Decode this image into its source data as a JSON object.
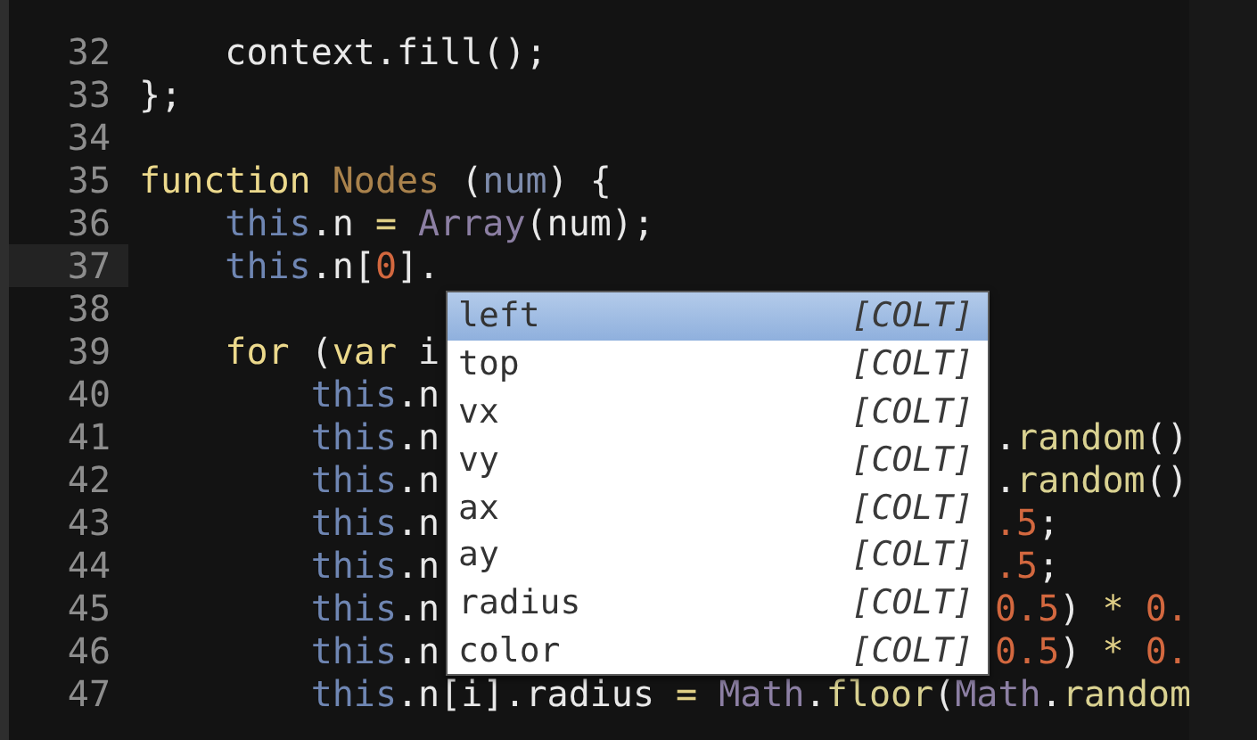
{
  "lines": [
    {
      "number": "32",
      "current": false,
      "segments": [
        {
          "text": "    context.fill();",
          "kind": "plain"
        }
      ]
    },
    {
      "number": "33",
      "current": false,
      "segments": [
        {
          "text": "};",
          "kind": "plain"
        }
      ]
    },
    {
      "number": "34",
      "current": false
    },
    {
      "number": "35",
      "current": false,
      "segments": [
        {
          "text": "function",
          "kind": "keyword"
        },
        {
          "text": " Nodes",
          "kind": "name"
        },
        {
          "text": " (",
          "kind": "plain"
        },
        {
          "text": "num",
          "kind": "param"
        },
        {
          "text": ") {",
          "kind": "plain"
        }
      ]
    },
    {
      "number": "36",
      "current": false,
      "segments": [
        {
          "text": "    this",
          "kind": "this"
        },
        {
          "text": ".n ",
          "kind": "plain"
        },
        {
          "text": "= ",
          "kind": "operator"
        },
        {
          "text": "Array",
          "kind": "builtin"
        },
        {
          "text": "(num);",
          "kind": "plain"
        }
      ]
    },
    {
      "number": "37",
      "current": true,
      "segments": [
        {
          "text": "    this",
          "kind": "this"
        },
        {
          "text": ".n[",
          "kind": "plain"
        },
        {
          "text": "0",
          "kind": "number"
        },
        {
          "text": "].",
          "kind": "plain"
        }
      ]
    },
    {
      "number": "38",
      "current": false
    },
    {
      "number": "39",
      "current": false,
      "segments": [
        {
          "text": "    for",
          "kind": "keyword"
        },
        {
          "text": " (",
          "kind": "plain"
        },
        {
          "text": "var",
          "kind": "keyword"
        },
        {
          "text": " i",
          "kind": "plain"
        }
      ]
    },
    {
      "number": "40",
      "current": false,
      "segments": [
        {
          "text": "        this",
          "kind": "this"
        },
        {
          "text": ".n",
          "kind": "plain"
        }
      ]
    },
    {
      "number": "41",
      "current": false,
      "segments": [
        {
          "text": "        this",
          "kind": "this"
        },
        {
          "text": ".n",
          "kind": "plain"
        }
      ],
      "tail": [
        {
          "text": ".",
          "kind": "plain"
        },
        {
          "text": "random",
          "kind": "method"
        },
        {
          "text": "()",
          "kind": "plain"
        }
      ]
    },
    {
      "number": "42",
      "current": false,
      "segments": [
        {
          "text": "        this",
          "kind": "this"
        },
        {
          "text": ".n",
          "kind": "plain"
        }
      ],
      "tail": [
        {
          "text": ".",
          "kind": "plain"
        },
        {
          "text": "random",
          "kind": "method"
        },
        {
          "text": "()",
          "kind": "plain"
        }
      ]
    },
    {
      "number": "43",
      "current": false,
      "segments": [
        {
          "text": "        this",
          "kind": "this"
        },
        {
          "text": ".n",
          "kind": "plain"
        }
      ],
      "tail": [
        {
          "text": ".5",
          "kind": "number"
        },
        {
          "text": ";",
          "kind": "plain"
        }
      ]
    },
    {
      "number": "44",
      "current": false,
      "segments": [
        {
          "text": "        this",
          "kind": "this"
        },
        {
          "text": ".n",
          "kind": "plain"
        }
      ],
      "tail": [
        {
          "text": ".5",
          "kind": "number"
        },
        {
          "text": ";",
          "kind": "plain"
        }
      ]
    },
    {
      "number": "45",
      "current": false,
      "segments": [
        {
          "text": "        this",
          "kind": "this"
        },
        {
          "text": ".n",
          "kind": "plain"
        }
      ],
      "tail": [
        {
          "text": "0.5",
          "kind": "number"
        },
        {
          "text": ") ",
          "kind": "plain"
        },
        {
          "text": "* ",
          "kind": "operator"
        },
        {
          "text": "0.",
          "kind": "number"
        }
      ]
    },
    {
      "number": "46",
      "current": false,
      "segments": [
        {
          "text": "        this",
          "kind": "this"
        },
        {
          "text": ".n",
          "kind": "plain"
        }
      ],
      "tail": [
        {
          "text": "0.5",
          "kind": "number"
        },
        {
          "text": ") ",
          "kind": "plain"
        },
        {
          "text": "* ",
          "kind": "operator"
        },
        {
          "text": "0.",
          "kind": "number"
        }
      ]
    },
    {
      "number": "47",
      "current": false,
      "segments": [
        {
          "text": "        this",
          "kind": "this"
        },
        {
          "text": ".n[i].radius ",
          "kind": "plain"
        },
        {
          "text": "= ",
          "kind": "operator"
        },
        {
          "text": "Math",
          "kind": "builtin"
        },
        {
          "text": ".",
          "kind": "plain"
        },
        {
          "text": "floor",
          "kind": "method"
        },
        {
          "text": "(",
          "kind": "plain"
        },
        {
          "text": "Math",
          "kind": "builtin"
        },
        {
          "text": ".",
          "kind": "plain"
        },
        {
          "text": "random",
          "kind": "method"
        }
      ]
    }
  ],
  "completion": {
    "items": [
      {
        "label": "left",
        "source": "[COLT]",
        "selected": true
      },
      {
        "label": "top",
        "source": "[COLT]",
        "selected": false
      },
      {
        "label": "vx",
        "source": "[COLT]",
        "selected": false
      },
      {
        "label": "vy",
        "source": "[COLT]",
        "selected": false
      },
      {
        "label": "ax",
        "source": "[COLT]",
        "selected": false
      },
      {
        "label": "ay",
        "source": "[COLT]",
        "selected": false
      },
      {
        "label": "radius",
        "source": "[COLT]",
        "selected": false
      },
      {
        "label": "color",
        "source": "[COLT]",
        "selected": false
      }
    ]
  }
}
